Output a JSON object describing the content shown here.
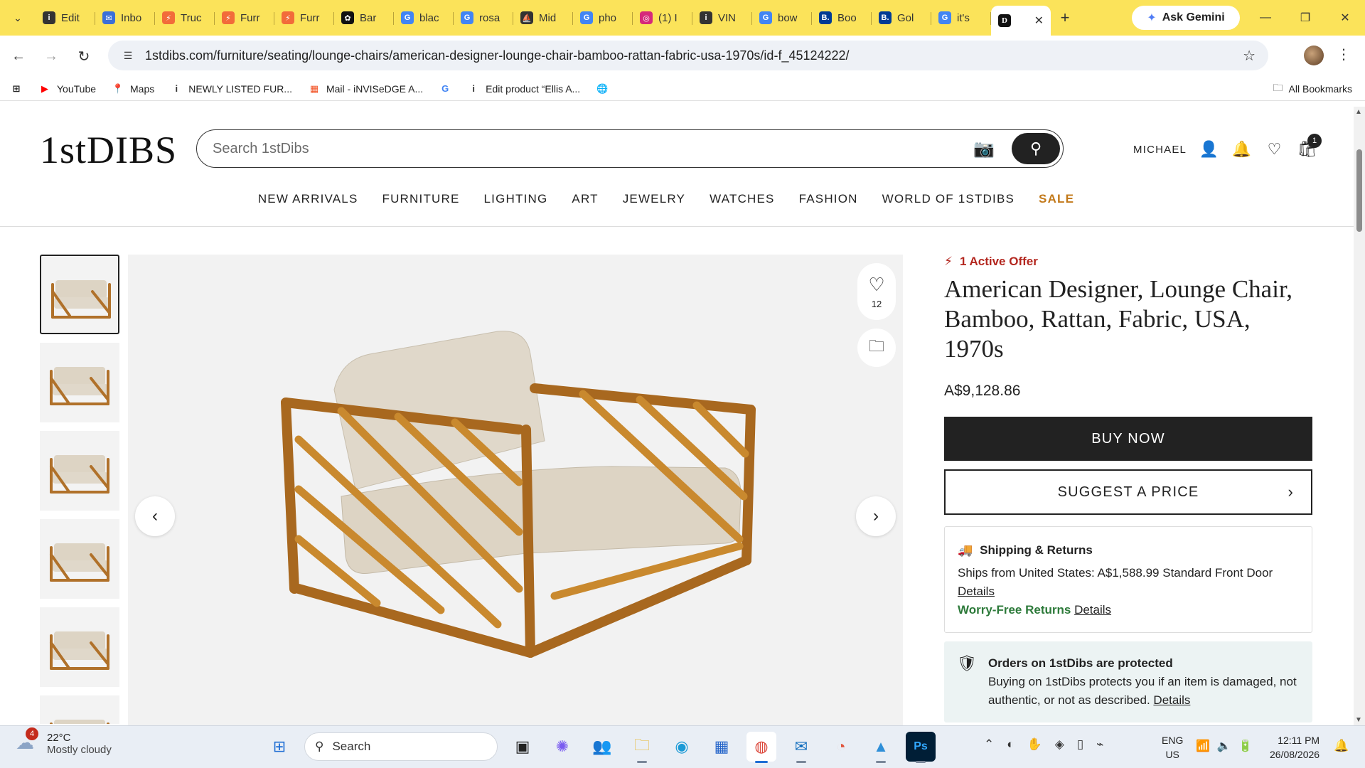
{
  "browser": {
    "tabs": [
      {
        "label": "Edit",
        "icon": "info-icon",
        "color": "#333333",
        "glyph": "i"
      },
      {
        "label": "Inbo",
        "icon": "mail-icon",
        "color": "#3b6fd8",
        "glyph": "✉"
      },
      {
        "label": "Truc",
        "icon": "bolt-icon",
        "color": "#f26b3a",
        "glyph": "⚡"
      },
      {
        "label": "Furr",
        "icon": "bolt-icon",
        "color": "#f26b3a",
        "glyph": "⚡"
      },
      {
        "label": "Furr",
        "icon": "bolt-icon",
        "color": "#f26b3a",
        "glyph": "⚡"
      },
      {
        "label": "Bar",
        "icon": "chatgpt-icon",
        "color": "#111111",
        "glyph": "✿"
      },
      {
        "label": "blac",
        "icon": "google-icon",
        "color": "#4285f4",
        "glyph": "G"
      },
      {
        "label": "rosa",
        "icon": "google-icon",
        "color": "#4285f4",
        "glyph": "G"
      },
      {
        "label": "Mid",
        "icon": "midjourney-icon",
        "color": "#333333",
        "glyph": "⛵"
      },
      {
        "label": "pho",
        "icon": "google-icon",
        "color": "#4285f4",
        "glyph": "G"
      },
      {
        "label": "(1) I",
        "icon": "instagram-icon",
        "color": "#d6297a",
        "glyph": "◎"
      },
      {
        "label": "VIN",
        "icon": "info-icon",
        "color": "#333333",
        "glyph": "i"
      },
      {
        "label": "bow",
        "icon": "google-icon",
        "color": "#4285f4",
        "glyph": "G"
      },
      {
        "label": "Boo",
        "icon": "booking-icon",
        "color": "#003b95",
        "glyph": "B."
      },
      {
        "label": "Gol",
        "icon": "booking-icon",
        "color": "#003b95",
        "glyph": "B."
      },
      {
        "label": "it's",
        "icon": "google-icon",
        "color": "#4285f4",
        "glyph": "G"
      }
    ],
    "active_tab_icon": "1stdibs-icon",
    "ask_gemini": "Ask Gemini",
    "url": "1stdibs.com/furniture/seating/lounge-chairs/american-designer-lounge-chair-bamboo-rattan-fabric-usa-1970s/id-f_45124222/",
    "bookmarks": [
      {
        "label": "YouTube",
        "icon": "youtube-icon",
        "color": "#ff0000",
        "glyph": "▶"
      },
      {
        "label": "Maps",
        "icon": "maps-icon",
        "color": "#34a853",
        "glyph": "📍"
      },
      {
        "label": "NEWLY LISTED FUR...",
        "icon": "info-icon",
        "color": "#333333",
        "glyph": "i"
      },
      {
        "label": "Mail - iNVISeDGE A...",
        "icon": "microsoft-icon",
        "color": "#f25022",
        "glyph": "▦"
      },
      {
        "label": "",
        "icon": "google-icon",
        "color": "#4285f4",
        "glyph": "G"
      },
      {
        "label": "Edit product “Ellis A...",
        "icon": "info-icon",
        "color": "#333333",
        "glyph": "i"
      },
      {
        "label": "",
        "icon": "globe-icon",
        "color": "#333333",
        "glyph": "🌐"
      }
    ],
    "all_bookmarks": "All Bookmarks"
  },
  "site": {
    "logo": "1stDIBS",
    "search_placeholder": "Search 1stDibs",
    "user": "MICHAEL",
    "cart_count": "1",
    "nav": [
      "NEW ARRIVALS",
      "FURNITURE",
      "LIGHTING",
      "ART",
      "JEWELRY",
      "WATCHES",
      "FASHION",
      "WORLD OF 1STDIBS"
    ],
    "nav_sale": "SALE",
    "sale_color": "#c2791a"
  },
  "product": {
    "offer": "1 Active Offer",
    "title": "American Designer, Lounge Chair, Bamboo, Rattan, Fabric, USA, 1970s",
    "price": "A$9,128.86",
    "favorites": "12",
    "buy_now": "BUY NOW",
    "suggest": "SUGGEST A PRICE",
    "shipping": {
      "heading": "Shipping & Returns",
      "text": "Ships from United States: A$1,588.99 Standard Front Door",
      "details": "Details",
      "returns": "Worry-Free Returns",
      "returns_details": "Details"
    },
    "protection": {
      "heading": "Orders on 1stDibs are protected",
      "text": "Buying on 1stDibs protects you if an item is damaged, not authentic, or not as described.",
      "details": "Details"
    }
  },
  "taskbar": {
    "weather_temp": "22°C",
    "weather_desc": "Mostly cloudy",
    "weather_badge": "4",
    "search": "Search",
    "lang1": "ENG",
    "lang2": "US",
    "time": "12:11 PM",
    "date": "26/08/2026"
  }
}
